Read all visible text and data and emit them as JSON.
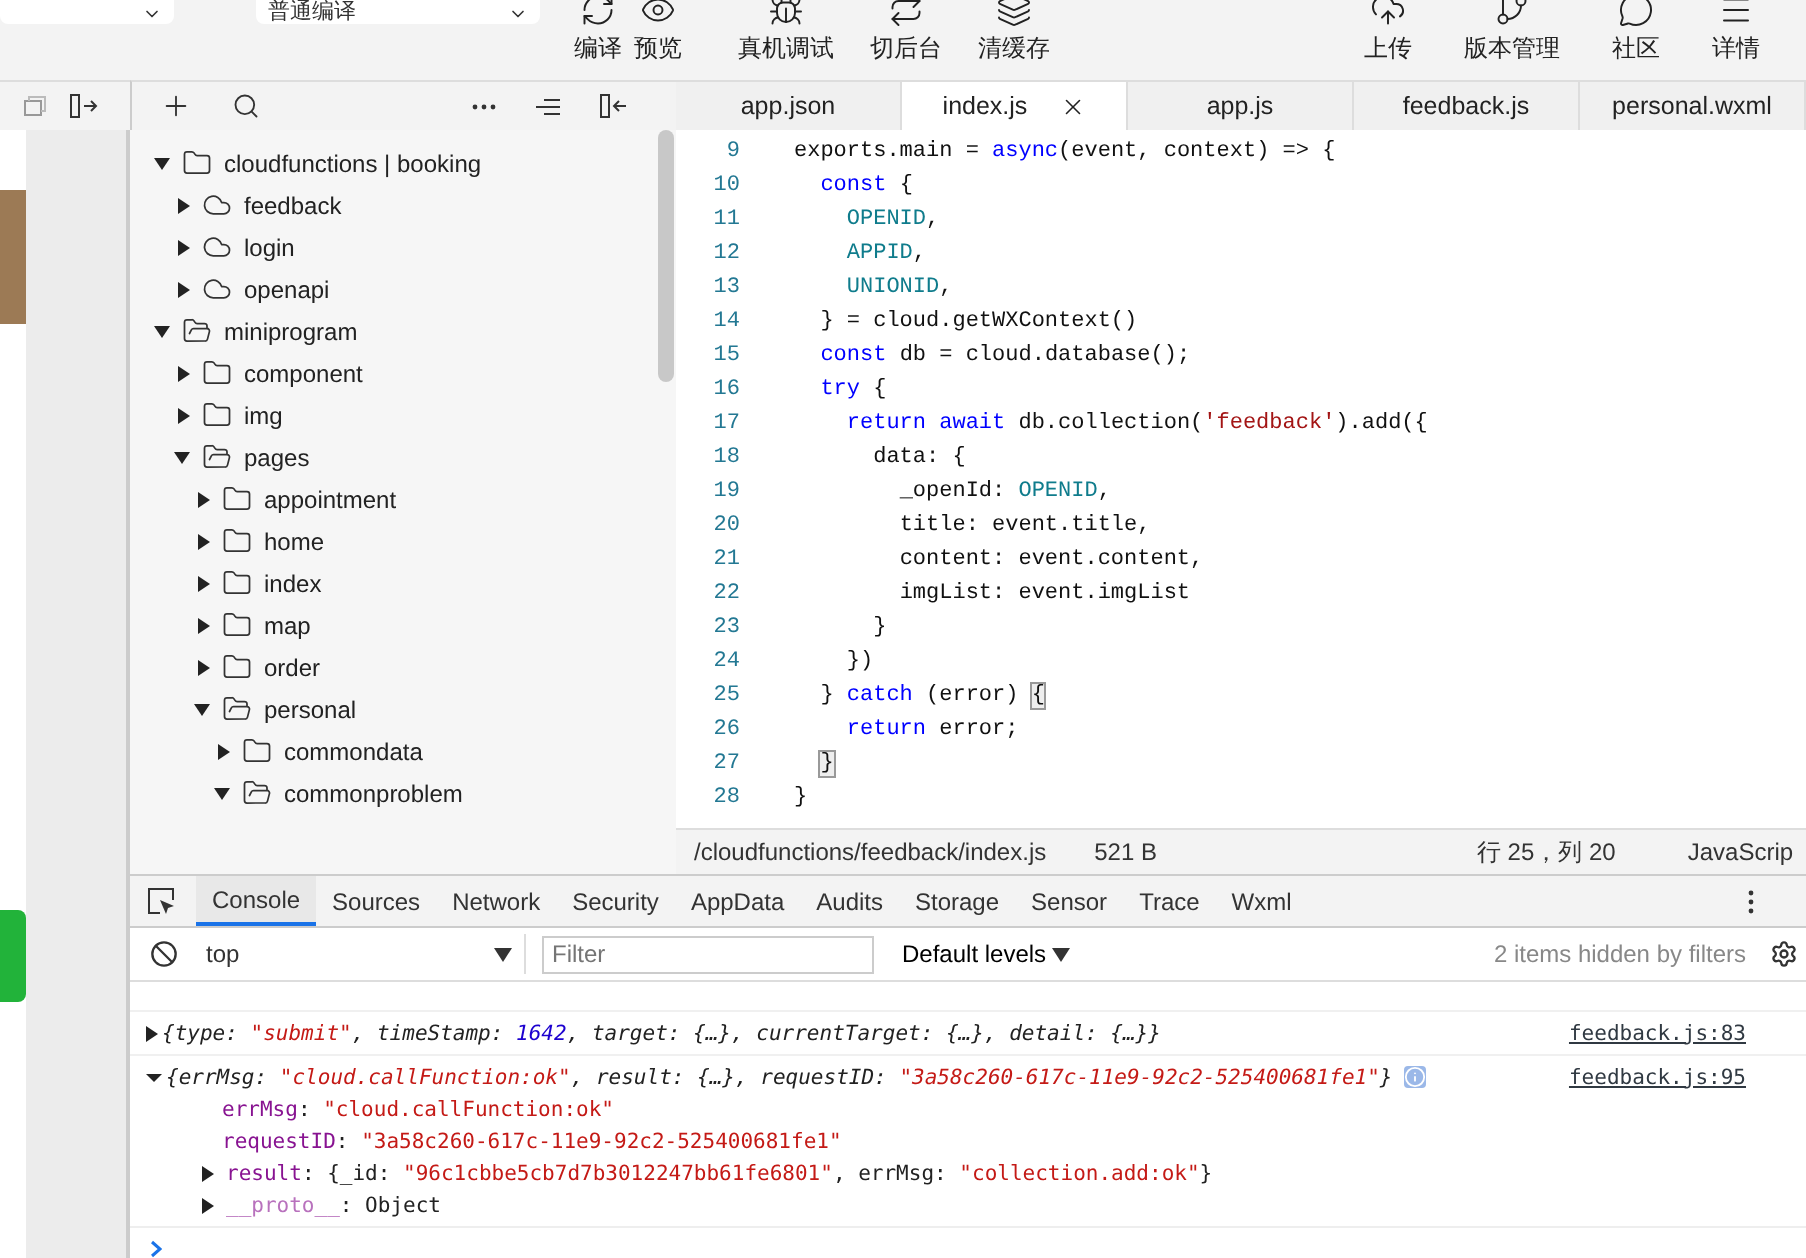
{
  "toolbar": {
    "compile_mode": "普通编译",
    "buttons": [
      {
        "label": "编译"
      },
      {
        "label": "预览"
      },
      {
        "label": "真机调试"
      },
      {
        "label": "切后台"
      },
      {
        "label": "清缓存"
      }
    ],
    "right_buttons": [
      {
        "label": "上传"
      },
      {
        "label": "版本管理"
      },
      {
        "label": "社区"
      },
      {
        "label": "详情"
      }
    ]
  },
  "editor_tabs": [
    {
      "label": "app.json",
      "selected": false
    },
    {
      "label": "index.js",
      "selected": true
    },
    {
      "label": "app.js",
      "selected": false
    },
    {
      "label": "feedback.js",
      "selected": false
    },
    {
      "label": "personal.wxml",
      "selected": false
    }
  ],
  "file_tree": [
    {
      "label": "cloudfunctions | booking",
      "kind": "cloud-root",
      "expanded": true,
      "children": [
        {
          "label": "feedback",
          "kind": "cloud",
          "expanded": false
        },
        {
          "label": "login",
          "kind": "cloud",
          "expanded": false
        },
        {
          "label": "openapi",
          "kind": "cloud",
          "expanded": false
        }
      ]
    },
    {
      "label": "miniprogram",
      "kind": "folder",
      "expanded": true,
      "children": [
        {
          "label": "component",
          "kind": "folder",
          "expanded": false
        },
        {
          "label": "img",
          "kind": "folder",
          "expanded": false
        },
        {
          "label": "pages",
          "kind": "folder",
          "expanded": true,
          "children": [
            {
              "label": "appointment",
              "kind": "folder",
              "expanded": false
            },
            {
              "label": "home",
              "kind": "folder",
              "expanded": false
            },
            {
              "label": "index",
              "kind": "folder",
              "expanded": false
            },
            {
              "label": "map",
              "kind": "folder",
              "expanded": false
            },
            {
              "label": "order",
              "kind": "folder",
              "expanded": false
            },
            {
              "label": "personal",
              "kind": "folder",
              "expanded": true,
              "children": [
                {
                  "label": "commondata",
                  "kind": "folder",
                  "expanded": false
                },
                {
                  "label": "commonproblem",
                  "kind": "folder",
                  "expanded": true
                }
              ]
            }
          ]
        }
      ]
    }
  ],
  "code_lines": [
    {
      "number": "9",
      "tokens": [
        {
          "text": "exports.main = ",
          "kind": "plain"
        },
        {
          "text": "async",
          "kind": "keyword"
        },
        {
          "text": "(event, context) => {",
          "kind": "plain"
        }
      ]
    },
    {
      "number": "10",
      "tokens": [
        {
          "text": "  const",
          "kind": "keyword"
        },
        {
          "text": " {",
          "kind": "plain"
        }
      ]
    },
    {
      "number": "11",
      "tokens": [
        {
          "text": "    OPENID",
          "kind": "constant"
        },
        {
          "text": ",",
          "kind": "plain"
        }
      ]
    },
    {
      "number": "12",
      "tokens": [
        {
          "text": "    APPID",
          "kind": "constant"
        },
        {
          "text": ",",
          "kind": "plain"
        }
      ]
    },
    {
      "number": "13",
      "tokens": [
        {
          "text": "    UNIONID",
          "kind": "constant"
        },
        {
          "text": ",",
          "kind": "plain"
        }
      ]
    },
    {
      "number": "14",
      "tokens": [
        {
          "text": "  } = cloud.getWXContext()",
          "kind": "plain"
        }
      ]
    },
    {
      "number": "15",
      "tokens": [
        {
          "text": "  const",
          "kind": "keyword"
        },
        {
          "text": " db = cloud.database();",
          "kind": "plain"
        }
      ]
    },
    {
      "number": "16",
      "tokens": [
        {
          "text": "  try",
          "kind": "keyword"
        },
        {
          "text": " {",
          "kind": "plain"
        }
      ]
    },
    {
      "number": "17",
      "tokens": [
        {
          "text": "    return await",
          "kind": "keyword"
        },
        {
          "text": " db.collection(",
          "kind": "plain"
        },
        {
          "text": "'feedback'",
          "kind": "string"
        },
        {
          "text": ").add({",
          "kind": "plain"
        }
      ]
    },
    {
      "number": "18",
      "tokens": [
        {
          "text": "      data: {",
          "kind": "plain"
        }
      ]
    },
    {
      "number": "19",
      "tokens": [
        {
          "text": "        _openId: ",
          "kind": "plain"
        },
        {
          "text": "OPENID",
          "kind": "constant"
        },
        {
          "text": ",",
          "kind": "plain"
        }
      ]
    },
    {
      "number": "20",
      "tokens": [
        {
          "text": "        title: event.title,",
          "kind": "plain"
        }
      ]
    },
    {
      "number": "21",
      "tokens": [
        {
          "text": "        content: event.content,",
          "kind": "plain"
        }
      ]
    },
    {
      "number": "22",
      "tokens": [
        {
          "text": "        imgList: event.imgList",
          "kind": "plain"
        }
      ]
    },
    {
      "number": "23",
      "tokens": [
        {
          "text": "      }",
          "kind": "plain"
        }
      ]
    },
    {
      "number": "24",
      "tokens": [
        {
          "text": "    })",
          "kind": "plain"
        }
      ]
    },
    {
      "number": "25",
      "tokens": [
        {
          "text": "  } ",
          "kind": "plain"
        },
        {
          "text": "catch",
          "kind": "keyword"
        },
        {
          "text": " (error) ",
          "kind": "plain"
        },
        {
          "text": "{",
          "kind": "bracket-match"
        }
      ]
    },
    {
      "number": "26",
      "tokens": [
        {
          "text": "    return",
          "kind": "keyword"
        },
        {
          "text": " error;",
          "kind": "plain"
        }
      ]
    },
    {
      "number": "27",
      "tokens": [
        {
          "text": "  }",
          "kind": "bracket-match"
        }
      ]
    },
    {
      "number": "28",
      "tokens": [
        {
          "text": "}",
          "kind": "plain"
        }
      ]
    }
  ],
  "status_bar": {
    "path": "/cloudfunctions/feedback/index.js",
    "size": "521 B",
    "position": "行 25，列 20",
    "language": "JavaScrip"
  },
  "devtools_tabs": [
    {
      "label": "Console",
      "selected": true
    },
    {
      "label": "Sources",
      "selected": false
    },
    {
      "label": "Network",
      "selected": false
    },
    {
      "label": "Security",
      "selected": false
    },
    {
      "label": "AppData",
      "selected": false
    },
    {
      "label": "Audits",
      "selected": false
    },
    {
      "label": "Storage",
      "selected": false
    },
    {
      "label": "Sensor",
      "selected": false
    },
    {
      "label": "Trace",
      "selected": false
    },
    {
      "label": "Wxml",
      "selected": false
    }
  ],
  "console_filter": {
    "context": "top",
    "placeholder": "Filter",
    "levels": "Default levels",
    "hidden_note": "2 items hidden by filters"
  },
  "console_messages": [
    {
      "expanded": false,
      "source": "feedback.js:83",
      "tokens": [
        {
          "text": "{type: ",
          "kind": "plain"
        },
        {
          "text": "\"submit\"",
          "kind": "string"
        },
        {
          "text": ", timeStamp: ",
          "kind": "plain"
        },
        {
          "text": "1642",
          "kind": "number"
        },
        {
          "text": ", target: {…}, currentTarget: {…}, detail: {…}}",
          "kind": "plain"
        }
      ]
    },
    {
      "expanded": true,
      "source": "feedback.js:95",
      "tokens": [
        {
          "text": "{errMsg: ",
          "kind": "plain"
        },
        {
          "text": "\"cloud.callFunction:ok\"",
          "kind": "string"
        },
        {
          "text": ", result: {…}, requestID: ",
          "kind": "plain"
        },
        {
          "text": "\"3a58c260-617c-11e9-92c2-525400681fe1\"",
          "kind": "string"
        },
        {
          "text": "}",
          "kind": "plain"
        }
      ],
      "properties": [
        {
          "kind": "value",
          "tokens": [
            {
              "text": "errMsg",
              "kind": "key"
            },
            {
              "text": ": ",
              "kind": "plain"
            },
            {
              "text": "\"cloud.callFunction:ok\"",
              "kind": "string"
            }
          ]
        },
        {
          "kind": "value",
          "tokens": [
            {
              "text": "requestID",
              "kind": "key"
            },
            {
              "text": ": ",
              "kind": "plain"
            },
            {
              "text": "\"3a58c260-617c-11e9-92c2-525400681fe1\"",
              "kind": "string"
            }
          ]
        },
        {
          "kind": "object",
          "tokens": [
            {
              "text": "result",
              "kind": "key"
            },
            {
              "text": ": {_id: ",
              "kind": "plain"
            },
            {
              "text": "\"96c1cbbe5cb7d7b3012247bb61fe6801\"",
              "kind": "string"
            },
            {
              "text": ", errMsg: ",
              "kind": "plain"
            },
            {
              "text": "\"collection.add:ok\"",
              "kind": "string"
            },
            {
              "text": "}",
              "kind": "plain"
            }
          ]
        },
        {
          "kind": "object",
          "tokens": [
            {
              "text": "__proto__",
              "kind": "proto"
            },
            {
              "text": ": Object",
              "kind": "plain"
            }
          ]
        }
      ]
    }
  ]
}
